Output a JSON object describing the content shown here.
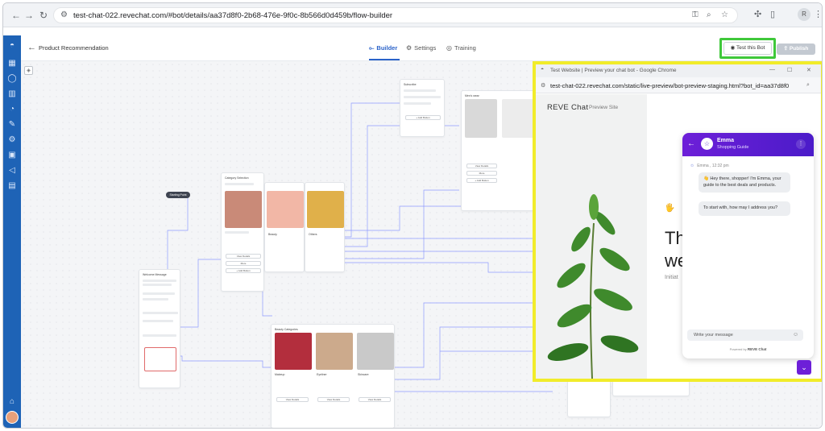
{
  "browser": {
    "url": "test-chat-022.revechat.com/#bot/details/aa37d8f0-2b68-476e-9f0c-8b566d0d459b/flow-builder",
    "profile_initial": "R"
  },
  "appbar": {
    "page_title": "Product Recommendation",
    "tabs": [
      {
        "label": "Builder"
      },
      {
        "label": "Settings"
      },
      {
        "label": "Training"
      }
    ],
    "test_label": "Test this Bot",
    "publish_label": "Publish"
  },
  "canvas": {
    "start_label": "Starting Point",
    "nodes": {
      "welcome_title": "Welcome Message",
      "category_title": "Category Selection",
      "beauty_title": "Beauty Categories",
      "subscribe_title": "Subscribe",
      "products_title": "Men's wear"
    },
    "tiles": {
      "gadgets": "Gadgets",
      "beauty": "Beauty",
      "others": "Others",
      "makeup": "Makeup",
      "eyeliner": "Eyeliner",
      "skincare": "Skincare"
    },
    "buttons": {
      "view_details": "View Details",
      "more": "More",
      "add_button": "+ Add Button"
    }
  },
  "preview": {
    "window_title": "Test Website | Preview your chat bot - Google Chrome",
    "url": "test-chat-022.revechat.com/static/live-preview/bot-preview-staging.html?bot_id=aa37d8f0",
    "brand": "REVE Chat",
    "brand_sub": "Preview Site",
    "hero_wave": "🖐",
    "hero_big1": "Th",
    "hero_big2": "we",
    "hero_small": "Initiat"
  },
  "chat": {
    "agent_name": "Emma",
    "agent_role": "Shopping Guide",
    "meta": "Emma , 12:32 pm",
    "message1": "👋 Hey there, shopper! I'm Emma, your guide to the best deals and products.",
    "message2": "To start with, how may I address you?",
    "input_placeholder": "Write your message",
    "powered_prefix": "Powered by",
    "powered_brand": "REVE Chat"
  },
  "colors": {
    "sidebar": "#1e63b6",
    "accent": "#2a62c9",
    "highlight_green": "#3fc83a",
    "highlight_yellow": "#f1ec2a",
    "chat_purple": "#6d1fd8"
  }
}
